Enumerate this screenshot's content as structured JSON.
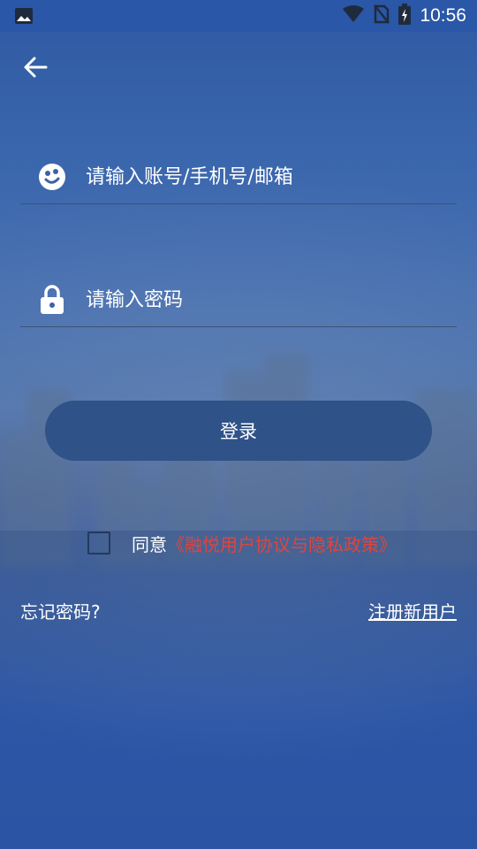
{
  "status_bar": {
    "time": "10:56",
    "icons": [
      "image-icon",
      "wifi-icon",
      "no-sim-icon",
      "battery-charging-icon"
    ]
  },
  "nav": {
    "back_icon": "arrow-left-icon"
  },
  "login_form": {
    "account_placeholder": "请输入账号/手机号/邮箱",
    "account_icon": "user-face-icon",
    "password_placeholder": "请输入密码",
    "password_icon": "lock-icon",
    "login_label": "登录"
  },
  "agreement": {
    "prefix": "同意",
    "link_text": "《融悦用户协议与隐私政策》",
    "checked": false
  },
  "links": {
    "forgot_password": "忘记密码?",
    "register": "注册新用户"
  },
  "colors": {
    "background": "#2b54a4",
    "button": "#2f5288",
    "link_red": "#e0443f"
  }
}
